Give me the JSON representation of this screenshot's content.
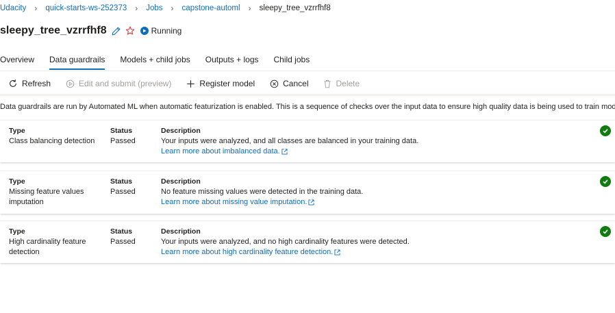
{
  "breadcrumb": {
    "items": [
      "Udacity",
      "quick-starts-ws-252373",
      "Jobs",
      "capstone-automl"
    ],
    "current": "sleepy_tree_vzrrfhf8"
  },
  "run": {
    "title": "sleepy_tree_vzrrfhf8",
    "status": "Running",
    "status_color": "#0f6cbd"
  },
  "tabs": [
    {
      "label": "Overview",
      "active": false
    },
    {
      "label": "Data guardrails",
      "active": true
    },
    {
      "label": "Models + child jobs",
      "active": false
    },
    {
      "label": "Outputs + logs",
      "active": false
    },
    {
      "label": "Child jobs",
      "active": false
    }
  ],
  "toolbar": {
    "refresh": "Refresh",
    "edit_submit": "Edit and submit (preview)",
    "register_model": "Register model",
    "cancel": "Cancel",
    "delete": "Delete"
  },
  "info": "Data guardrails are run by Automated ML when automatic featurization is enabled. This is a sequence of checks over the input data to ensure high quality data is being used to train model.",
  "headers": {
    "type": "Type",
    "status": "Status",
    "description": "Description"
  },
  "guardrails": [
    {
      "type": "Class balancing detection",
      "status": "Passed",
      "description": "Your inputs were analyzed, and all classes are balanced in your training data.",
      "link": "Learn more about imbalanced data."
    },
    {
      "type": "Missing feature values imputation",
      "status": "Passed",
      "description": "No feature missing values were detected in the training data.",
      "link": "Learn more about missing value imputation."
    },
    {
      "type": "High cardinality feature detection",
      "status": "Passed",
      "description": "Your inputs were analyzed, and no high cardinality features were detected.",
      "link": "Learn more about high cardinality feature detection."
    }
  ],
  "colors": {
    "accent": "#0f6cbd",
    "success": "#107c10",
    "favorite": "#d13438"
  }
}
